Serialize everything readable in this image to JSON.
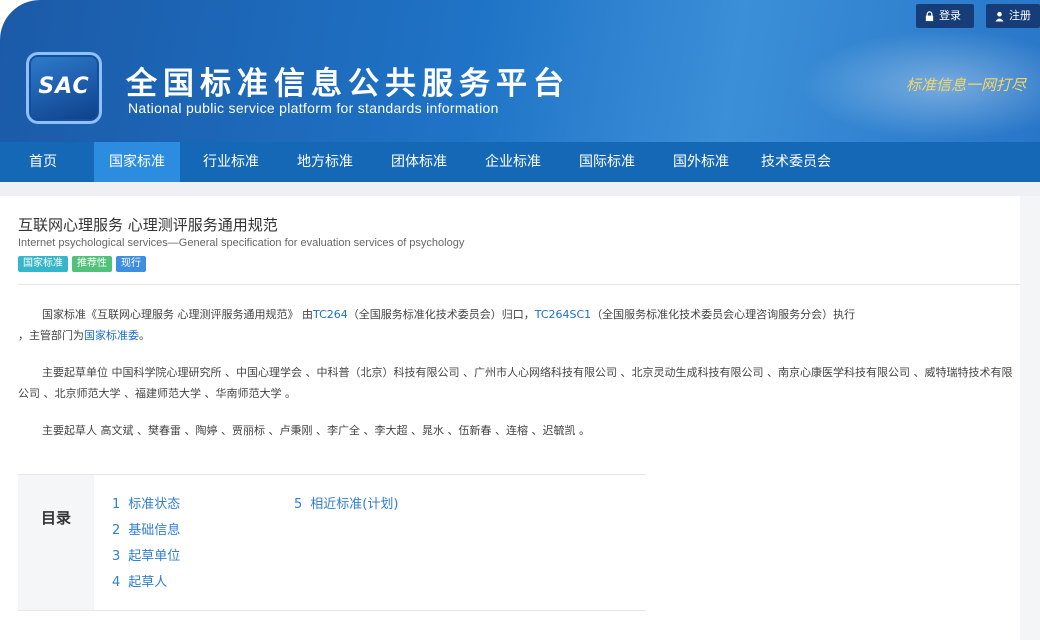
{
  "header": {
    "logo_text": "SAC",
    "title": "全国标准信息公共服务平台",
    "subtitle": "National public service platform  for standards information",
    "slogan": "标准信息一网打尽",
    "login_label": "登录",
    "register_label": "注册"
  },
  "nav": {
    "items": [
      {
        "label": "首页"
      },
      {
        "label": "国家标准"
      },
      {
        "label": "行业标准"
      },
      {
        "label": "地方标准"
      },
      {
        "label": "团体标准"
      },
      {
        "label": "企业标准"
      },
      {
        "label": "国际标准"
      },
      {
        "label": "国外标准"
      },
      {
        "label": "技术委员会"
      }
    ],
    "active": "国家标准"
  },
  "standard": {
    "title_cn": "互联网心理服务 心理测评服务通用规范",
    "title_en": "Internet psychological services—General specification for evaluation services of psychology",
    "tags": [
      "国家标准",
      "推荐性",
      "现行"
    ]
  },
  "description": {
    "p1_a": "国家标准《互联网心理服务 心理测评服务通用规范》 由",
    "p1_link1": "TC264",
    "p1_b": "（全国服务标准化技术委员会）归口，",
    "p1_link2": "TC264SC1",
    "p1_c": "（全国服务标准化技术委员会心理咨询服务分会）执行",
    "p1_d": "，主管部门为",
    "p1_link3": "国家标准委",
    "p1_e": "。",
    "p2": "主要起草单位 中国科学院心理研究所 、中国心理学会 、中科普（北京）科技有限公司 、广州市人心网络科技有限公司 、北京灵动生成科技有限公司 、南京心康医学科技有限公司 、威特瑞特技术有限公司 、北京师范大学 、福建师范大学 、华南师范大学 。",
    "p3": "主要起草人 高文斌 、樊春雷 、陶婷 、贾丽标 、卢秉刚 、李广全 、李大超 、晁水 、伍新春 、连榕 、迟毓凯 。"
  },
  "toc": {
    "heading": "目录",
    "items": [
      {
        "num": "1",
        "label": "标准状态"
      },
      {
        "num": "2",
        "label": "基础信息"
      },
      {
        "num": "3",
        "label": "起草单位"
      },
      {
        "num": "4",
        "label": "起草人"
      },
      {
        "num": "5",
        "label": "相近标准(计划)"
      }
    ]
  },
  "colors": {
    "header_blue": "#1f73c6",
    "nav_blue": "#1568b6",
    "nav_active": "#2c8ce0",
    "link": "#1f6fc4",
    "tag_national": "#35b6c9",
    "tag_recommended": "#52c27a",
    "tag_current": "#3f8fe0"
  }
}
